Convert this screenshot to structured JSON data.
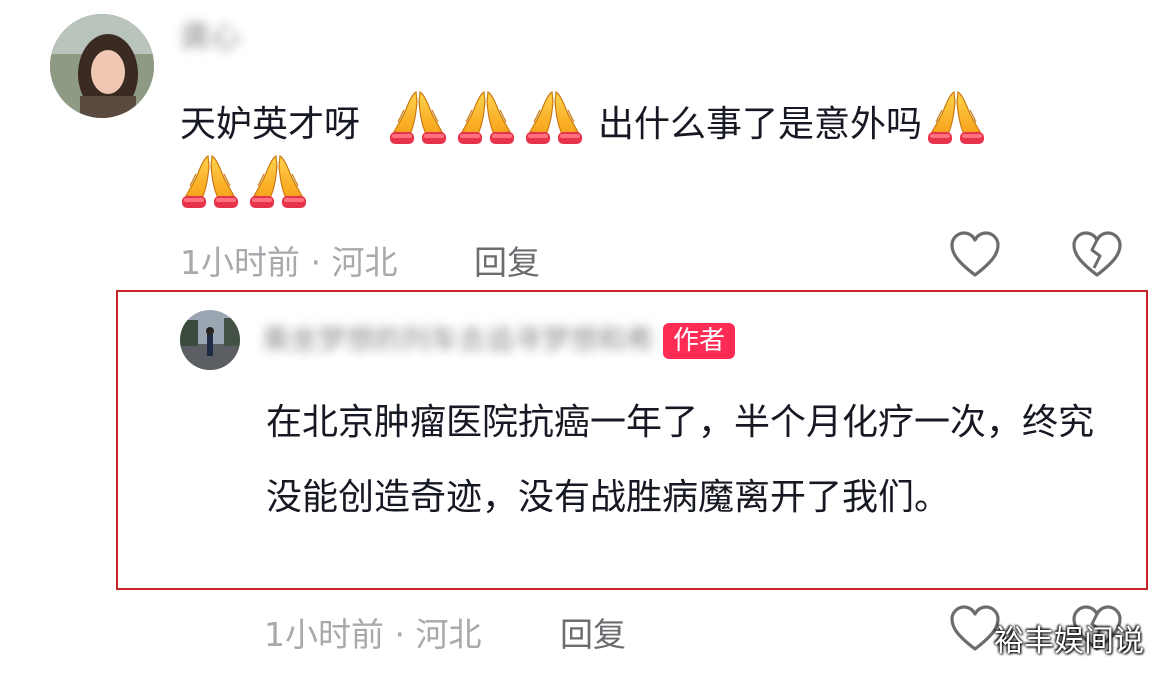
{
  "comment": {
    "username": "龚心",
    "text_part1": "天妒英才呀",
    "text_part2": "出什么事了是意外吗",
    "emoji": "folded-hands",
    "time_location": "1小时前 · 河北",
    "reply_label": "回复",
    "like_icon": "heart-outline-icon",
    "dislike_icon": "broken-heart-icon"
  },
  "reply": {
    "username": "乘坐梦想的列车去追寻梦想和希望",
    "author_badge": "作者",
    "text": "在北京肿瘤医院抗癌一年了，半个月化疗一次，终究没能创造奇迹，没有战胜病魔离开了我们。",
    "time_location": "1小时前 · 河北",
    "reply_label": "回复",
    "like_icon": "heart-outline-icon",
    "dislike_icon": "broken-heart-icon"
  },
  "watermark": "裕丰娱间说",
  "colors": {
    "accent_badge": "#fe2c55",
    "highlight_border": "#c8242a",
    "meta_text": "#a8a8ad"
  }
}
